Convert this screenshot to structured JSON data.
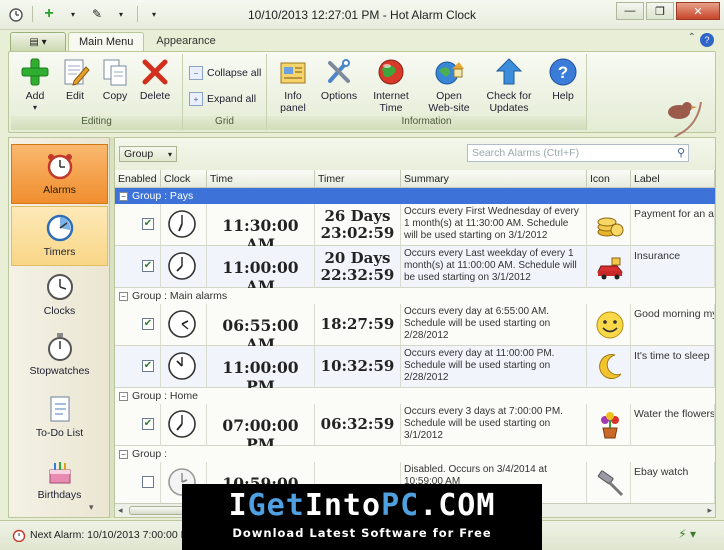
{
  "window": {
    "title": "10/10/2013 12:27:01 PM - Hot Alarm Clock",
    "controls": [
      "minimize",
      "restore",
      "close"
    ]
  },
  "ribbon": {
    "tabs": [
      "Main Menu",
      "Appearance"
    ],
    "active_tab": "Main Menu",
    "groups": {
      "editing": {
        "label": "Editing",
        "buttons": [
          "Add",
          "Edit",
          "Copy",
          "Delete"
        ]
      },
      "grid": {
        "label": "Grid",
        "buttons": [
          "Collapse all",
          "Expand all"
        ]
      },
      "information": {
        "label": "Information",
        "info_panel": "Info\npanel",
        "options": "Options",
        "internet_time": "Internet\nTime",
        "open_website": "Open\nWeb-site",
        "check_updates": "Check for\nUpdates",
        "help": "Help"
      }
    }
  },
  "nav": {
    "items": [
      "Alarms",
      "Timers",
      "Clocks",
      "Stopwatches",
      "To-Do List",
      "Birthdays"
    ],
    "active": "Alarms"
  },
  "toolbar": {
    "group_select": "Group",
    "search_placeholder": "Search Alarms (Ctrl+F)"
  },
  "table": {
    "columns": [
      "Enabled",
      "Clock",
      "Time",
      "Timer",
      "Summary",
      "Icon",
      "Label"
    ],
    "groups": [
      {
        "name": "Group : Pays",
        "rows": [
          {
            "enabled": true,
            "time": "11:30:00 AM",
            "timer_line1": "26 Days",
            "timer_line2": "23:02:59",
            "summary": "Occurs every First Wednesday of every 1 month(s) at 11:30:00 AM. Schedule will be used starting on 3/1/2012",
            "icon": "coins-icon",
            "label": "Payment for an ap"
          },
          {
            "enabled": true,
            "time": "11:00:00 AM",
            "timer_line1": "20 Days",
            "timer_line2": "22:32:59",
            "summary": "Occurs every Last weekday of every 1 month(s) at 11:00:00 AM. Schedule will be used starting on 3/1/2012",
            "icon": "car-icon",
            "label": "Insurance"
          }
        ]
      },
      {
        "name": "Group : Main alarms",
        "rows": [
          {
            "enabled": true,
            "time": "06:55:00 AM",
            "timer_line1": "18:27:59",
            "timer_line2": "",
            "summary": "Occurs every day at 6:55:00 AM. Schedule will be used starting on 2/28/2012",
            "icon": "smiley-icon",
            "label": "Good morning my"
          },
          {
            "enabled": true,
            "time": "11:00:00 PM",
            "timer_line1": "10:32:59",
            "timer_line2": "",
            "summary": "Occurs every day at 11:00:00 PM. Schedule will be used starting on 2/28/2012",
            "icon": "moon-icon",
            "label": "It's time to sleep"
          }
        ]
      },
      {
        "name": "Group : Home",
        "rows": [
          {
            "enabled": true,
            "time": "07:00:00 PM",
            "timer_line1": "06:32:59",
            "timer_line2": "",
            "summary": "Occurs every 3 days at 7:00:00 PM. Schedule will be used starting on 3/1/2012",
            "icon": "flower-pot-icon",
            "label": "Water the flowers"
          }
        ]
      },
      {
        "name": "Group :",
        "rows": [
          {
            "enabled": false,
            "time": "10:59:00 AM",
            "timer_line1": "",
            "timer_line2": "",
            "summary": "Disabled. Occurs on 3/4/2014 at 10:59:00 AM",
            "icon": "gavel-icon",
            "label": "Ebay watch"
          }
        ]
      }
    ]
  },
  "status": {
    "next_alarm": "Next Alarm: 10/10/2013 7:00:00 PM"
  },
  "watermark": {
    "brand_pre": "I",
    "brand_get": "Get",
    "brand_into": "Into",
    "brand_pc": "PC",
    "brand_dot": ".COM",
    "tagline": "Download Latest Software for Free"
  },
  "colors": {
    "ribbon_bg": "#e4ecd5",
    "active_nav": "#f08e2f",
    "group_selected": "#3d73d9",
    "watermark_accent": "#4fa0e0"
  }
}
